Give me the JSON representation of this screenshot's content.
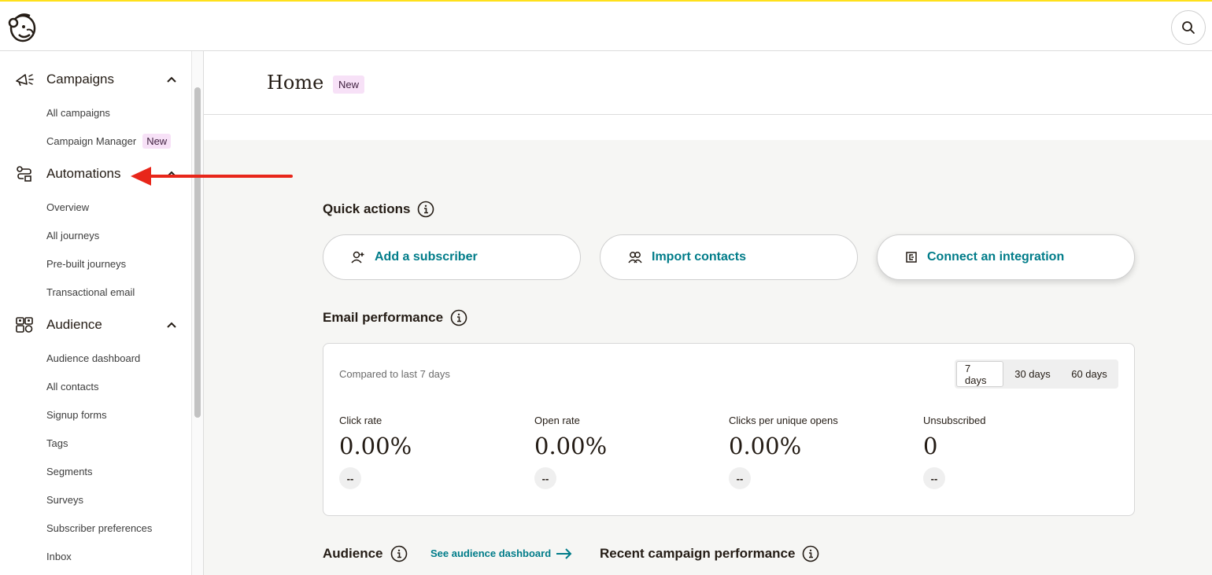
{
  "colors": {
    "accent": "#007c89",
    "badge_bg": "#f7e1f7",
    "top_line": "#ffe01b",
    "annotation_arrow": "#e8261a"
  },
  "topbar": {
    "logo_icon": "mailchimp-logo-icon",
    "search_icon": "search-icon"
  },
  "sidebar": {
    "groups": [
      {
        "label": "Campaigns",
        "icon": "megaphone-icon",
        "expanded": true,
        "items": [
          {
            "label": "All campaigns"
          },
          {
            "label": "Campaign Manager",
            "badge": "New"
          }
        ]
      },
      {
        "label": "Automations",
        "icon": "automation-flow-icon",
        "expanded": true,
        "items": [
          {
            "label": "Overview"
          },
          {
            "label": "All journeys"
          },
          {
            "label": "Pre-built journeys"
          },
          {
            "label": "Transactional email"
          }
        ]
      },
      {
        "label": "Audience",
        "icon": "audience-icon",
        "expanded": true,
        "items": [
          {
            "label": "Audience dashboard"
          },
          {
            "label": "All contacts"
          },
          {
            "label": "Signup forms"
          },
          {
            "label": "Tags"
          },
          {
            "label": "Segments"
          },
          {
            "label": "Surveys"
          },
          {
            "label": "Subscriber preferences"
          },
          {
            "label": "Inbox"
          }
        ]
      }
    ]
  },
  "header": {
    "title": "Home",
    "badge": "New"
  },
  "quick_actions": {
    "heading": "Quick actions",
    "buttons": [
      {
        "label": "Add a subscriber",
        "icon": "add-user-icon"
      },
      {
        "label": "Import contacts",
        "icon": "contacts-icon"
      },
      {
        "label": "Connect an integration",
        "icon": "integration-icon"
      }
    ]
  },
  "email_performance": {
    "heading": "Email performance",
    "compared_text": "Compared to last 7 days",
    "ranges": [
      "7 days",
      "30 days",
      "60 days"
    ],
    "selected_range": "7 days",
    "metrics": [
      {
        "label": "Click rate",
        "value": "0.00%",
        "delta": "--"
      },
      {
        "label": "Open rate",
        "value": "0.00%",
        "delta": "--"
      },
      {
        "label": "Clicks per unique opens",
        "value": "0.00%",
        "delta": "--"
      },
      {
        "label": "Unsubscribed",
        "value": "0",
        "delta": "--"
      }
    ]
  },
  "audience": {
    "heading": "Audience",
    "link": "See audience dashboard"
  },
  "recent_campaign": {
    "heading": "Recent campaign performance"
  }
}
